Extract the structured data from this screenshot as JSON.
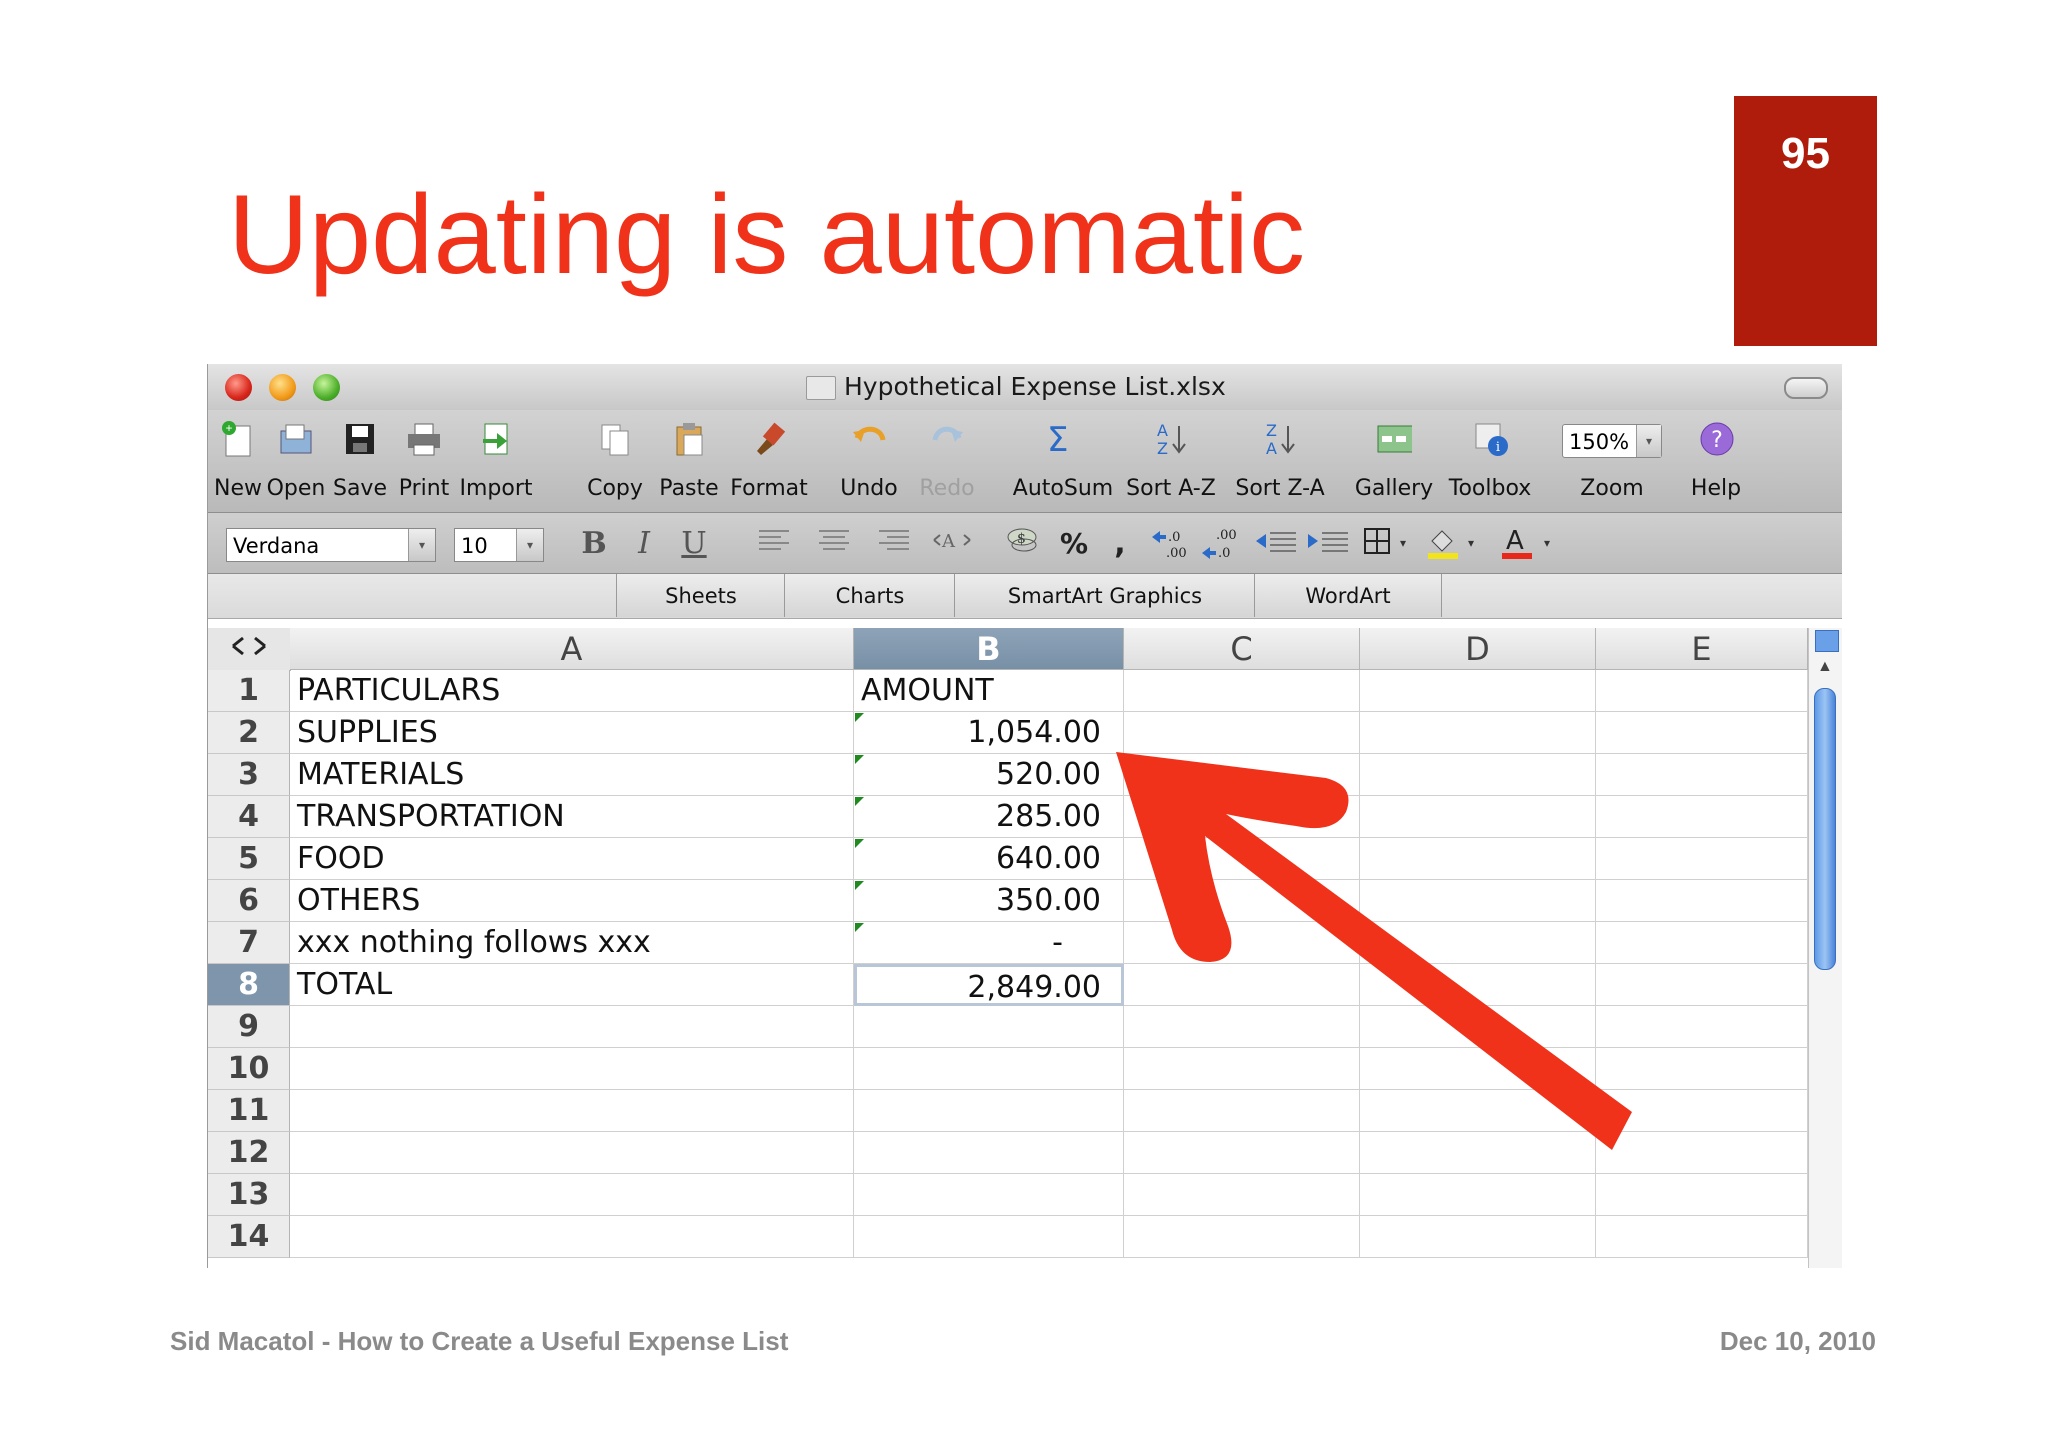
{
  "slide": {
    "page_number": "95",
    "title": "Updating is automatic",
    "footer_left": "Sid Macatol - How to Create a Useful Expense List",
    "footer_right": "Dec 10, 2010"
  },
  "window": {
    "title": "Hypothetical Expense List.xlsx"
  },
  "toolbar": {
    "items": [
      {
        "label": "New",
        "icon": "new-icon"
      },
      {
        "label": "Open",
        "icon": "open-icon"
      },
      {
        "label": "Save",
        "icon": "save-icon"
      },
      {
        "label": "Print",
        "icon": "print-icon"
      },
      {
        "label": "Import",
        "icon": "import-icon"
      },
      {
        "label": "Copy",
        "icon": "copy-icon"
      },
      {
        "label": "Paste",
        "icon": "paste-icon"
      },
      {
        "label": "Format",
        "icon": "format-brush-icon"
      },
      {
        "label": "Undo",
        "icon": "undo-icon"
      },
      {
        "label": "Redo",
        "icon": "redo-icon",
        "disabled": true
      },
      {
        "label": "AutoSum",
        "icon": "sigma-icon"
      },
      {
        "label": "Sort A-Z",
        "icon": "sort-az-icon"
      },
      {
        "label": "Sort Z-A",
        "icon": "sort-za-icon"
      },
      {
        "label": "Gallery",
        "icon": "gallery-icon"
      },
      {
        "label": "Toolbox",
        "icon": "toolbox-icon"
      },
      {
        "label": "Zoom",
        "value": "150%"
      },
      {
        "label": "Help",
        "icon": "help-icon"
      }
    ]
  },
  "format_bar": {
    "font": "Verdana",
    "size": "10",
    "bold": "B",
    "italic": "I",
    "underline": "U",
    "percent": "%",
    "comma": ",",
    "text_color_glyph": "A"
  },
  "ribbon_tabs": [
    "Sheets",
    "Charts",
    "SmartArt Graphics",
    "WordArt"
  ],
  "sheet": {
    "columns": [
      "A",
      "B",
      "C",
      "D",
      "E"
    ],
    "selected_column": "B",
    "selected_row": "8",
    "row_numbers": [
      "1",
      "2",
      "3",
      "4",
      "5",
      "6",
      "7",
      "8",
      "9",
      "10",
      "11",
      "12",
      "13",
      "14"
    ],
    "rows": [
      {
        "a": "PARTICULARS",
        "b": "AMOUNT"
      },
      {
        "a": "SUPPLIES",
        "b": "1,054.00"
      },
      {
        "a": "MATERIALS",
        "b": "520.00"
      },
      {
        "a": "TRANSPORTATION",
        "b": "285.00"
      },
      {
        "a": "FOOD",
        "b": "640.00"
      },
      {
        "a": "OTHERS",
        "b": "350.00"
      },
      {
        "a": "xxx nothing follows xxx",
        "b": "-"
      },
      {
        "a": "TOTAL",
        "b": "2,849.00"
      }
    ]
  },
  "colors": {
    "title": "#f0321a",
    "page_badge": "#b01c0c",
    "arrow": "#f0321a"
  }
}
